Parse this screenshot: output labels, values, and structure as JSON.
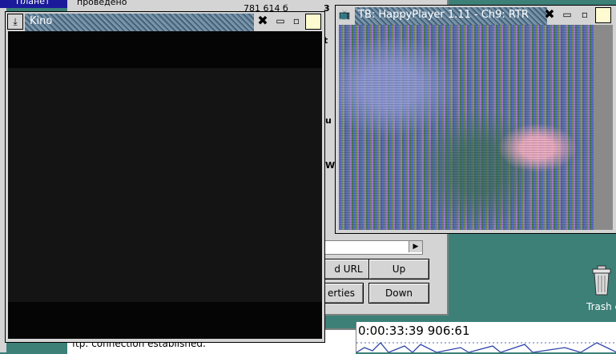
{
  "background_window": {
    "row1": "проведено",
    "row2": "781 614 б",
    "frag_3": "3",
    "frag_t": "t",
    "frag_u": "u",
    "frag_w": "W",
    "buttons": {
      "add_url": "d URL",
      "up": "Up",
      "properties": "erties",
      "down": "Down"
    }
  },
  "left_label": "Планет",
  "log": {
    "line": "ftp: connection established."
  },
  "timeline": {
    "timecode": "0:00:33:39 906:61"
  },
  "desktop": {
    "trash_label": "Trash c"
  },
  "kino": {
    "title": "Kino"
  },
  "player": {
    "title": "TB: HappyPlayer 1.11 - Ch9: RTR"
  },
  "icons": {
    "close": "close-icon",
    "minimize": "minimize-icon",
    "restore": "restore-icon",
    "maximize": "maximize-icon"
  }
}
